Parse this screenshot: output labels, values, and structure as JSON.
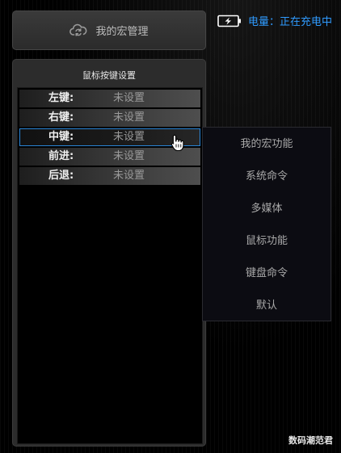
{
  "macro_button": {
    "label": "我的宏管理",
    "icon": "cloud-sync-icon"
  },
  "battery": {
    "status": "电量：正在充电中",
    "icon": "battery-charging-icon",
    "color": "#2f9bff"
  },
  "panel": {
    "title": "鼠标按键设置",
    "keys": [
      {
        "name": "左键:",
        "value": "未设置"
      },
      {
        "name": "右键:",
        "value": "未设置"
      },
      {
        "name": "中键:",
        "value": "未设置"
      },
      {
        "name": "前进:",
        "value": "未设置"
      },
      {
        "name": "后退:",
        "value": "未设置"
      }
    ],
    "active_index": 2,
    "highlight_color": "#2a86d8"
  },
  "menu": {
    "items": [
      "我的宏功能",
      "系统命令",
      "多媒体",
      "鼠标功能",
      "键盘命令",
      "默认"
    ]
  },
  "watermark": "数码潮范君"
}
